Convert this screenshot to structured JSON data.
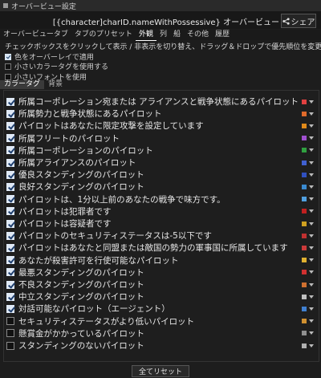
{
  "window": {
    "title": "オーバービュー設定"
  },
  "header": {
    "text": "[{character]charID.nameWithPossessive} オーバービュー",
    "share_label": "シェア"
  },
  "tabs": [
    {
      "label": "オーバービュータブ",
      "active": false
    },
    {
      "label": "タブのプリセット",
      "active": false
    },
    {
      "label": "外観",
      "active": true
    },
    {
      "label": "列",
      "active": false
    },
    {
      "label": "船",
      "active": false
    },
    {
      "label": "その他",
      "active": false
    },
    {
      "label": "履歴",
      "active": false
    }
  ],
  "description": "チェックボックスをクリックして表示 / 非表示を切り替え、ドラッグ＆ドロップで優先順位を変更",
  "options": [
    {
      "label": "色をオーバーレイで適用",
      "checked": true
    },
    {
      "label": "小さいカラータグを使用する",
      "checked": false
    },
    {
      "label": "小さいフォントを使用",
      "checked": false
    }
  ],
  "subtabs": [
    {
      "label": "カラータグ",
      "active": true
    },
    {
      "label": "背景",
      "active": false
    }
  ],
  "tags": [
    {
      "label": "所属コーポレーション宛または アライアンスと戦争状態にあるパイロット",
      "checked": true,
      "color": "#e04040"
    },
    {
      "label": "所属勢力と戦争状態にあるパイロット",
      "checked": true,
      "color": "#e06a2a"
    },
    {
      "label": "パイロットはあなたに限定攻撃を設定しています",
      "checked": true,
      "color": "#e08a1a"
    },
    {
      "label": "所属フリートのパイロット",
      "checked": true,
      "color": "#a050d0"
    },
    {
      "label": "所属コーポレーションのパイロット",
      "checked": true,
      "color": "#30a040"
    },
    {
      "label": "所属アライアンスのパイロット",
      "checked": true,
      "color": "#4060d0"
    },
    {
      "label": "優良スタンディングのパイロット",
      "checked": true,
      "color": "#3050c0"
    },
    {
      "label": "良好スタンディングのパイロット",
      "checked": true,
      "color": "#3a8ad0"
    },
    {
      "label": "パイロットは、1分以上前のあなたの戦争で味方です。",
      "checked": true,
      "color": "#50a0e0"
    },
    {
      "label": "パイロットは犯罪者です",
      "checked": true,
      "color": "#c02020"
    },
    {
      "label": "パイロットは容疑者です",
      "checked": true,
      "color": "#d0a020"
    },
    {
      "label": "パイロットのセキュリティステータスは-5以下です",
      "checked": true,
      "color": "#c03030"
    },
    {
      "label": "パイロットはあなたと同盟または敵国の勢力の軍事国に所属しています",
      "checked": true,
      "color": "#cc3a3a"
    },
    {
      "label": "あなたが殺害許可を行使可能なパイロット",
      "checked": true,
      "color": "#e0b030"
    },
    {
      "label": "最悪スタンディングのパイロット",
      "checked": true,
      "color": "#d03030"
    },
    {
      "label": "不良スタンディングのパイロット",
      "checked": true,
      "color": "#d07030"
    },
    {
      "label": "中立スタンディングのパイロット",
      "checked": true,
      "color": "#c0c0c0"
    },
    {
      "label": "対話可能なパイロット（エージェント）",
      "checked": true,
      "color": "#4080d0"
    },
    {
      "label": "セキュリティステータスがより低いパイロット",
      "checked": false,
      "color": "#d09030"
    },
    {
      "label": "懸賞金がかかっているパイロット",
      "checked": false,
      "color": "#909090"
    },
    {
      "label": "スタンディングのないパイロット",
      "checked": false,
      "color": "#b0b0b0"
    }
  ],
  "reset_label": "全てリセット"
}
